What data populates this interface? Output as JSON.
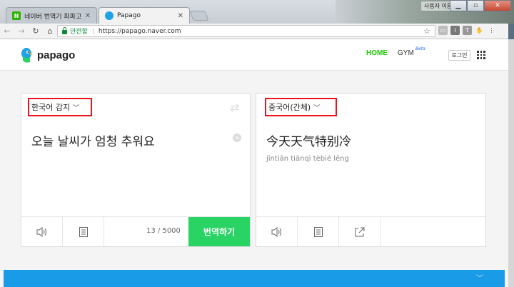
{
  "tabs": [
    {
      "title": "네이버 번역기 파파고 :",
      "favicon": "N",
      "active": false
    },
    {
      "title": "Papago",
      "favicon": "",
      "active": true
    }
  ],
  "window": {
    "user_badge": "사용자 이름 1"
  },
  "address": {
    "secure_label": "안전함",
    "url": "https://papago.naver.com"
  },
  "header": {
    "logo": "papago",
    "nav_home": "HOME",
    "nav_gym": "GYM",
    "nav_beta": "Beta",
    "login": "로그인"
  },
  "source": {
    "language": "한국어 감지",
    "text": "오늘 날씨가 엄청 추워요",
    "counter": "13 / 5000",
    "translate_label": "번역하기"
  },
  "target": {
    "language": "중국어(간체)",
    "text": "今天天气特别冷",
    "pinyin": "jīntiān tiānqì tèbié lěng"
  },
  "colors": {
    "accent_green": "#1ec800",
    "translate_button": "#29d465",
    "highlight_box": "#e8151e",
    "banner": "#1a9be8"
  }
}
